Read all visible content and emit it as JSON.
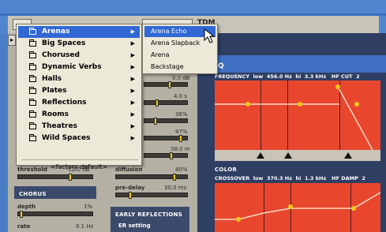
{
  "header": {
    "partial_title": "TDM"
  },
  "left_side_button": "▸",
  "left_panel": {
    "values": [
      "0.0 dB",
      "4.0 s",
      "36%",
      "97%",
      "38.0 m"
    ],
    "threshold": {
      "label": "threshold",
      "value": "-12.0 dB"
    },
    "diffusion": {
      "label": "diffusion",
      "value": "80%"
    },
    "predelay": {
      "label": "pre-delay",
      "value": "30.0 ms"
    },
    "chorus": {
      "title": "CHORUS",
      "depth_label": "depth",
      "depth_value": "1%",
      "rate_label": "rate",
      "rate_value": "0.1 Hz"
    },
    "early_reflections": {
      "title": "EARLY REFLECTIONS",
      "setting_label": "ER setting"
    }
  },
  "graph_top": {
    "title": "Q",
    "freq_label": "FREQUENCY",
    "low_label": "low",
    "low_value": "456.0 Hz",
    "hi_label": "hi",
    "hi_value": "3.3 kHz",
    "cut_label": "HF CUT",
    "cut_value": "2"
  },
  "graph_bottom": {
    "title": "COLOR",
    "crossover_label": "CROSSOVER",
    "low_label": "low",
    "low_value": "370.3 Hz",
    "hi_label": "hi",
    "hi_value": "1.3 kHz",
    "damp_label": "HF DAMP",
    "damp_value": "2"
  },
  "menu": {
    "items": [
      {
        "label": "Arenas",
        "selected": true
      },
      {
        "label": "Big Spaces"
      },
      {
        "label": "Chorused"
      },
      {
        "label": "Dynamic Verbs"
      },
      {
        "label": "Halls"
      },
      {
        "label": "Plates"
      },
      {
        "label": "Reflections"
      },
      {
        "label": "Rooms"
      },
      {
        "label": "Theatres"
      },
      {
        "label": "Wild Spaces"
      }
    ],
    "factory_default": "<factory default>"
  },
  "submenu": {
    "items": [
      {
        "label": "Arena Echo",
        "selected": true
      },
      {
        "label": "Arena Slapback"
      },
      {
        "label": "Arena"
      },
      {
        "label": "Backstage"
      }
    ]
  },
  "colors": {
    "menu_highlight": "#3168d4",
    "graph_red": "#e8472e",
    "panel_blue": "#2f3e63",
    "knob_yellow": "#f0c818"
  }
}
